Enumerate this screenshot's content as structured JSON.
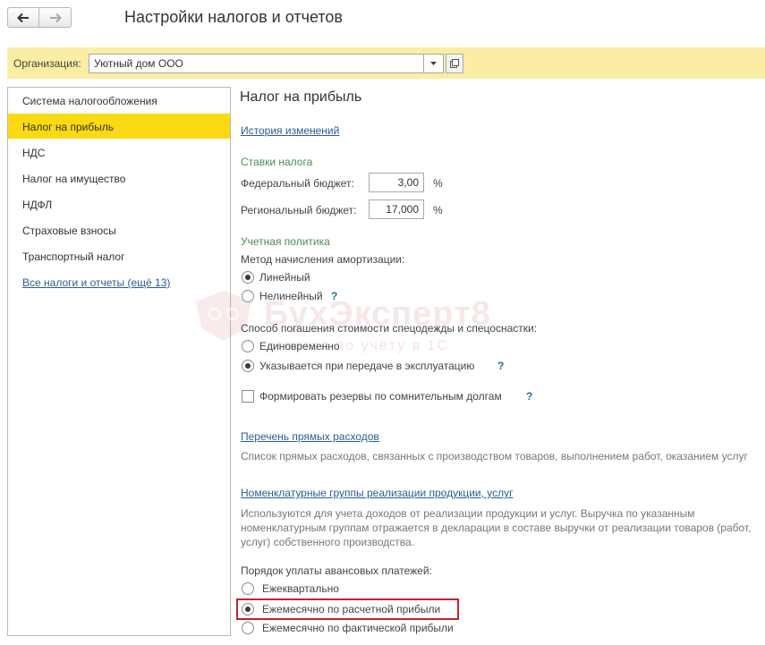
{
  "window": {
    "title": "Настройки налогов и отчетов"
  },
  "icons": {
    "back": "arrow-left-icon",
    "forward": "arrow-right-icon",
    "dropdown": "chevron-down-icon",
    "open": "open-window-icon"
  },
  "organization": {
    "label": "Организация:",
    "value": "Уютный дом ООО"
  },
  "sidebar": {
    "items": [
      {
        "label": "Система налогообложения"
      },
      {
        "label": "Налог на прибыль"
      },
      {
        "label": "НДС"
      },
      {
        "label": "Налог на имущество"
      },
      {
        "label": "НДФЛ"
      },
      {
        "label": "Страховые взносы"
      },
      {
        "label": "Транспортный налог"
      },
      {
        "label": "Все налоги и отчеты (ещё 13)"
      }
    ],
    "active_index": 1
  },
  "main": {
    "title": "Налог на прибыль",
    "history_link": "История изменений",
    "rates": {
      "heading": "Ставки налога",
      "federal_label": "Федеральный бюджет:",
      "federal_value": "3,00",
      "regional_label": "Региональный бюджет:",
      "regional_value": "17,000",
      "unit": "%"
    },
    "policy": {
      "heading": "Учетная политика",
      "amort_label": "Метод начисления амортизации:",
      "amort_linear": "Линейный",
      "amort_nonlinear": "Нелинейный",
      "amort_selected": "linear",
      "workwear_label": "Способ погашения стоимости спецодежды и спецоснастки:",
      "workwear_once": "Единовременно",
      "workwear_transfer": "Указывается при передаче в эксплуатацию",
      "workwear_selected": "transfer",
      "reserves_label": "Формировать резервы по сомнительным долгам",
      "reserves_checked": false,
      "help": "?"
    },
    "direct_costs": {
      "link": "Перечень прямых расходов",
      "desc": "Список прямых расходов, связанных с производством товаров, выполнением работ, оказанием услуг"
    },
    "nomenclature": {
      "link": "Номенклатурные группы реализации продукции, услуг",
      "desc": "Используются для учета доходов от реализации продукции и услуг. Выручка по указанным номенклатурным группам отражается в декларации в составе выручки от реализации товаров (работ, услуг) собственного производства."
    },
    "advance": {
      "heading": "Порядок уплаты авансовых платежей:",
      "quarterly": "Ежеквартально",
      "monthly_estimated": "Ежемесячно по расчетной прибыли",
      "monthly_actual": "Ежемесячно по фактической прибыли",
      "selected": "monthly_estimated"
    }
  },
  "watermark": {
    "brand": "БухЭксперт8",
    "tagline": "ответов по учёту в 1С"
  },
  "colors": {
    "accent": "#fbd913",
    "org_bar": "#fbeda3",
    "link": "#2a5e93",
    "section": "#4b8d54",
    "highlight": "#c0252a"
  }
}
